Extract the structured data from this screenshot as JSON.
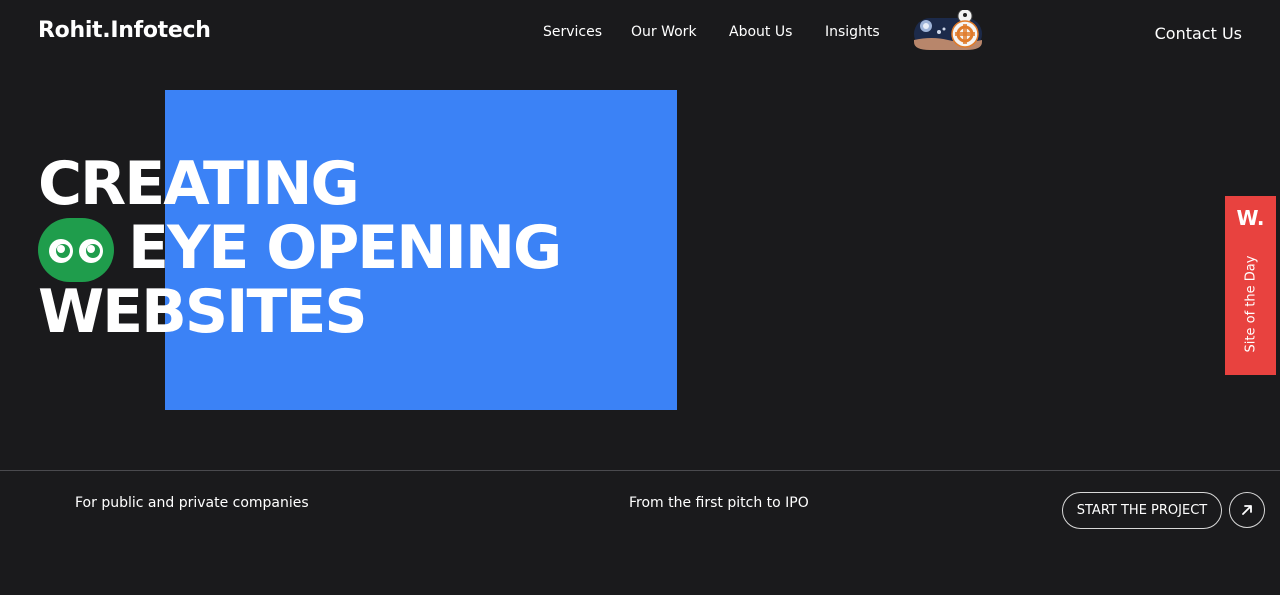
{
  "header": {
    "logo": "Rohit.Infotech",
    "nav": [
      "Services",
      "Our Work",
      "About Us",
      "Insights"
    ],
    "contact": "Contact Us",
    "theme_toggle_icon": "space-robot-toggle-icon"
  },
  "hero": {
    "line1": "CREATING",
    "line2": "EYE OPENING",
    "line3": "WEBSITES",
    "eyes_icon": "eyes-icon",
    "colors": {
      "accent_block": "#3b82f6",
      "eyes_badge": "#1f9d4c",
      "background": "#1a1a1c"
    }
  },
  "award_badge": {
    "mark": "W.",
    "label": "Site of the Day",
    "color": "#e8423f"
  },
  "footer": {
    "tagline_left": "For public and private companies",
    "tagline_mid": "From the first pitch to IPO",
    "cta_label": "START THE PROJECT",
    "cta_icon": "arrow-up-right-icon"
  }
}
